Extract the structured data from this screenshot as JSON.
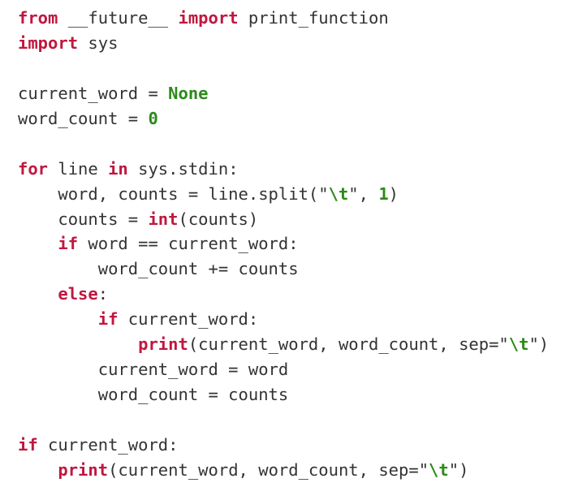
{
  "colors": {
    "keyword": "#c0173f",
    "literal": "#2c8a1a",
    "text": "#333333",
    "background": "#ffffff"
  },
  "lines": [
    [
      {
        "t": "kw",
        "v": "from"
      },
      {
        "t": "plain",
        "v": " __future__ "
      },
      {
        "t": "kw",
        "v": "import"
      },
      {
        "t": "plain",
        "v": " print_function"
      }
    ],
    [
      {
        "t": "kw",
        "v": "import"
      },
      {
        "t": "plain",
        "v": " sys"
      }
    ],
    [],
    [
      {
        "t": "plain",
        "v": "current_word = "
      },
      {
        "t": "lit",
        "v": "None"
      }
    ],
    [
      {
        "t": "plain",
        "v": "word_count = "
      },
      {
        "t": "lit",
        "v": "0"
      }
    ],
    [],
    [
      {
        "t": "kw",
        "v": "for"
      },
      {
        "t": "plain",
        "v": " line "
      },
      {
        "t": "kw",
        "v": "in"
      },
      {
        "t": "plain",
        "v": " sys.stdin:"
      }
    ],
    [
      {
        "t": "plain",
        "v": "    word, counts = line.split(\""
      },
      {
        "t": "esc",
        "v": "\\t"
      },
      {
        "t": "plain",
        "v": "\", "
      },
      {
        "t": "lit",
        "v": "1"
      },
      {
        "t": "plain",
        "v": ")"
      }
    ],
    [
      {
        "t": "plain",
        "v": "    counts = "
      },
      {
        "t": "kw",
        "v": "int"
      },
      {
        "t": "plain",
        "v": "(counts)"
      }
    ],
    [
      {
        "t": "plain",
        "v": "    "
      },
      {
        "t": "kw",
        "v": "if"
      },
      {
        "t": "plain",
        "v": " word == current_word:"
      }
    ],
    [
      {
        "t": "plain",
        "v": "        word_count += counts"
      }
    ],
    [
      {
        "t": "plain",
        "v": "    "
      },
      {
        "t": "kw",
        "v": "else"
      },
      {
        "t": "plain",
        "v": ":"
      }
    ],
    [
      {
        "t": "plain",
        "v": "        "
      },
      {
        "t": "kw",
        "v": "if"
      },
      {
        "t": "plain",
        "v": " current_word:"
      }
    ],
    [
      {
        "t": "plain",
        "v": "            "
      },
      {
        "t": "kw",
        "v": "print"
      },
      {
        "t": "plain",
        "v": "(current_word, word_count, sep=\""
      },
      {
        "t": "esc",
        "v": "\\t"
      },
      {
        "t": "plain",
        "v": "\")"
      }
    ],
    [
      {
        "t": "plain",
        "v": "        current_word = word"
      }
    ],
    [
      {
        "t": "plain",
        "v": "        word_count = counts"
      }
    ],
    [],
    [
      {
        "t": "kw",
        "v": "if"
      },
      {
        "t": "plain",
        "v": " current_word:"
      }
    ],
    [
      {
        "t": "plain",
        "v": "    "
      },
      {
        "t": "kw",
        "v": "print"
      },
      {
        "t": "plain",
        "v": "(current_word, word_count, sep=\""
      },
      {
        "t": "esc",
        "v": "\\t"
      },
      {
        "t": "plain",
        "v": "\")"
      }
    ]
  ]
}
